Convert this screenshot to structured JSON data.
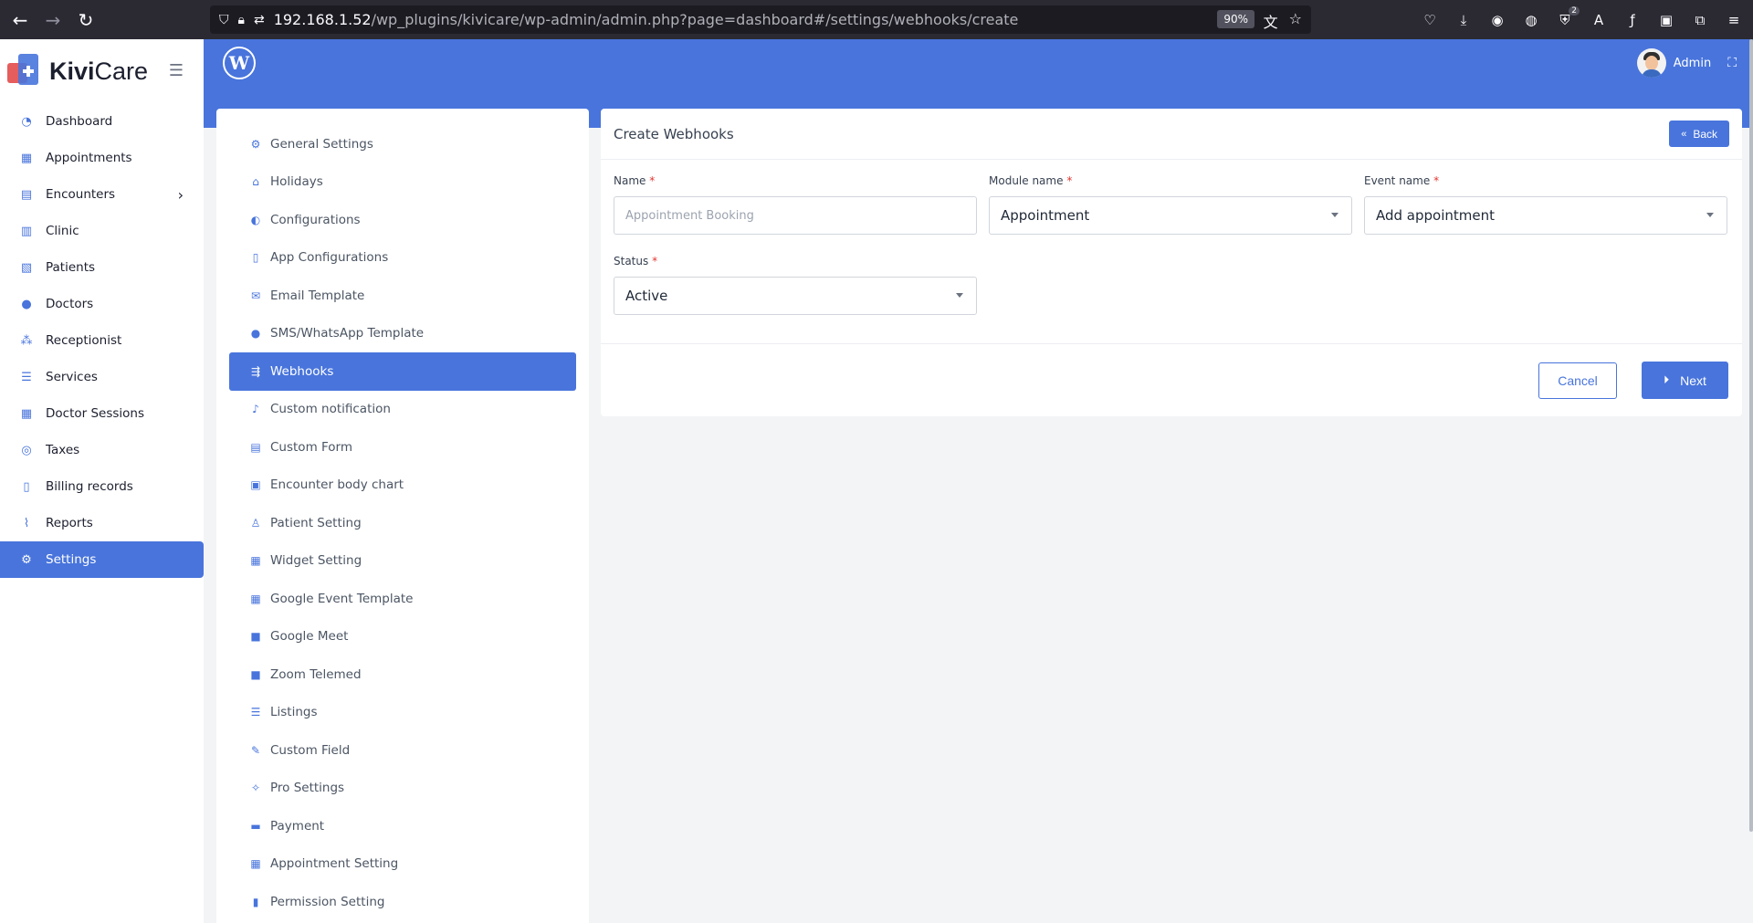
{
  "browser": {
    "url_host": "192.168.1.52",
    "url_path": "/wp_plugins/kivicare/wp-admin/admin.php?page=dashboard#/settings/webhooks/create",
    "zoom": "90%"
  },
  "brand": {
    "name_bold": "Kivi",
    "name_light": "Care"
  },
  "sidebar": {
    "items": [
      {
        "label": "Dashboard",
        "icon": "dashboard-icon"
      },
      {
        "label": "Appointments",
        "icon": "calendar-icon"
      },
      {
        "label": "Encounters",
        "icon": "calendar-check-icon"
      },
      {
        "label": "Clinic",
        "icon": "hospital-icon"
      },
      {
        "label": "Patients",
        "icon": "patients-icon"
      },
      {
        "label": "Doctors",
        "icon": "doctor-icon"
      },
      {
        "label": "Receptionist",
        "icon": "users-icon"
      },
      {
        "label": "Services",
        "icon": "services-icon"
      },
      {
        "label": "Doctor Sessions",
        "icon": "calendar-icon"
      },
      {
        "label": "Taxes",
        "icon": "tax-icon"
      },
      {
        "label": "Billing records",
        "icon": "billing-icon"
      },
      {
        "label": "Reports",
        "icon": "chart-icon"
      },
      {
        "label": "Settings",
        "icon": "cogs-icon"
      }
    ],
    "active": "Settings"
  },
  "header": {
    "user_name": "Admin"
  },
  "settings_nav": {
    "items": [
      "General Settings",
      "Holidays",
      "Configurations",
      "App Configurations",
      "Email Template",
      "SMS/WhatsApp Template",
      "Webhooks",
      "Custom notification",
      "Custom Form",
      "Encounter body chart",
      "Patient Setting",
      "Widget Setting",
      "Google Event Template",
      "Google Meet",
      "Zoom Telemed",
      "Listings",
      "Custom Field",
      "Pro Settings",
      "Payment",
      "Appointment Setting",
      "Permission Setting"
    ],
    "active": "Webhooks"
  },
  "form": {
    "title": "Create Webhooks",
    "back_label": "Back",
    "name_label": "Name",
    "name_placeholder": "Appointment Booking",
    "module_label": "Module name",
    "module_value": "Appointment",
    "event_label": "Event name",
    "event_value": "Add appointment",
    "status_label": "Status",
    "status_value": "Active",
    "required_mark": "*",
    "cancel_label": "Cancel",
    "next_label": "Next"
  },
  "colors": {
    "primary": "#4874dc",
    "required": "#e3342f"
  }
}
